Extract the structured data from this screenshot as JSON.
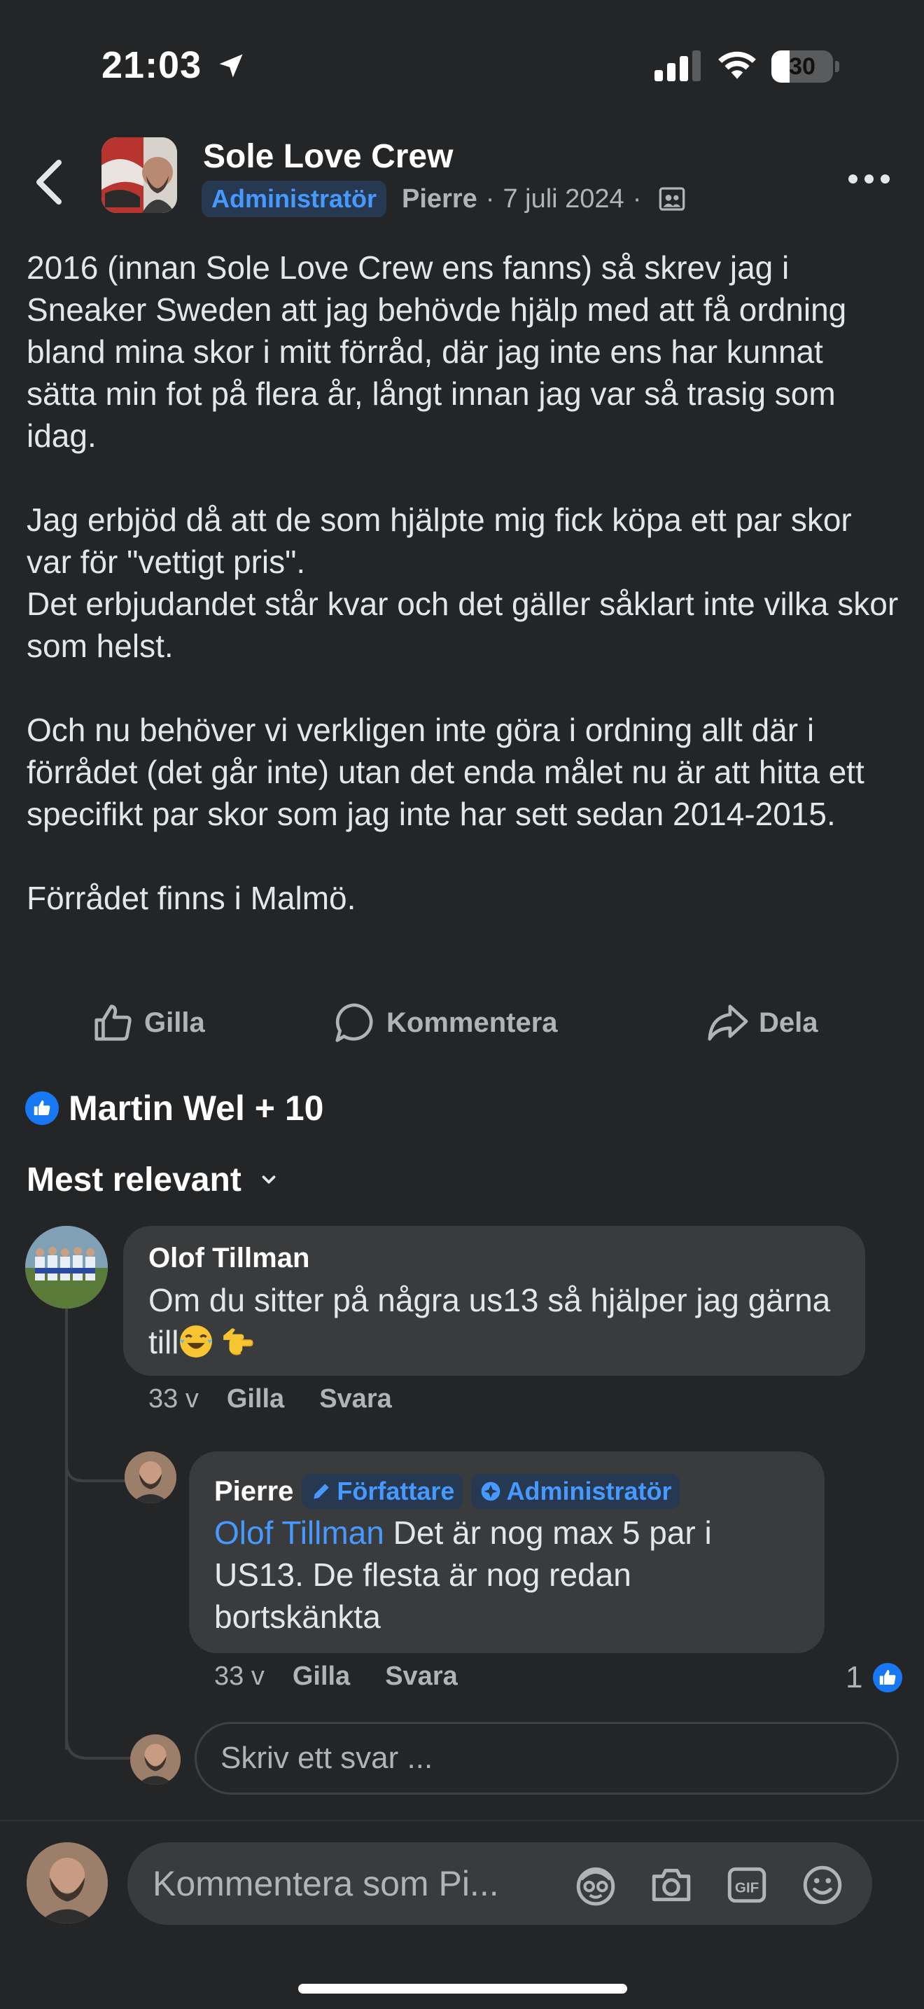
{
  "status_bar": {
    "time": "21:03",
    "battery": "30",
    "battery_level": 0.3
  },
  "header": {
    "group_name": "Sole Love Crew",
    "badge": "Administratör",
    "author": "Pierre",
    "separator": "·",
    "date": "7 juli 2024",
    "icons": [
      "back-chevron-icon",
      "group-privacy-icon",
      "more-icon"
    ]
  },
  "post": {
    "paragraphs": [
      "2016 (innan Sole Love Crew ens fanns) så skrev jag i Sneaker Sweden att jag behövde hjälp med att få ordning bland mina skor i mitt förråd, där jag inte ens har kunnat sätta min fot på flera år, långt innan jag var så trasig som idag.",
      "Jag erbjöd då att de som hjälpte mig fick köpa ett par skor var för \"vettigt pris\".\nDet erbjudandet står kvar och det gäller såklart inte vilka skor som helst.",
      "Och nu behöver vi verkligen inte göra i ordning allt där i förrådet (det går inte) utan det enda målet nu är att hitta ett specifikt par skor som jag inte har sett sedan 2014-2015.",
      "Förrådet finns i Malmö."
    ]
  },
  "actions": {
    "like": "Gilla",
    "comment": "Kommentera",
    "share": "Dela"
  },
  "reactions": {
    "text": "Martin Wel + 10"
  },
  "sort": {
    "label": "Mest relevant"
  },
  "comments": [
    {
      "author": "Olof Tillman",
      "text": "Om du sitter på några us13 så hjälper jag gärna till",
      "time": "33 v",
      "like": "Gilla",
      "reply": "Svara",
      "emojis": [
        "tears-of-joy-emoji",
        "pointing-hand-emoji"
      ]
    }
  ],
  "reply": {
    "author": "Pierre",
    "tag_author": "Författare",
    "tag_admin": "Administratör",
    "mention": "Olof Tillman",
    "text_line1": " Det är nog max 5 par i",
    "text_line2": "US13. De flesta är nog redan",
    "text_line3": "bortskänkta",
    "time": "33 v",
    "like": "Gilla",
    "reply": "Svara",
    "like_count": "1"
  },
  "reply_input": {
    "placeholder": "Skriv ett svar ..."
  },
  "composer": {
    "placeholder": "Kommentera som Pi...",
    "icons": [
      "avatar-sticker-icon",
      "camera-icon",
      "gif-icon",
      "emoji-icon"
    ]
  },
  "colors": {
    "background": "#242526",
    "bubble": "#3a3b3c",
    "accent": "#4599ff",
    "like_blue": "#1877f2",
    "badge_bg": "#263951"
  }
}
